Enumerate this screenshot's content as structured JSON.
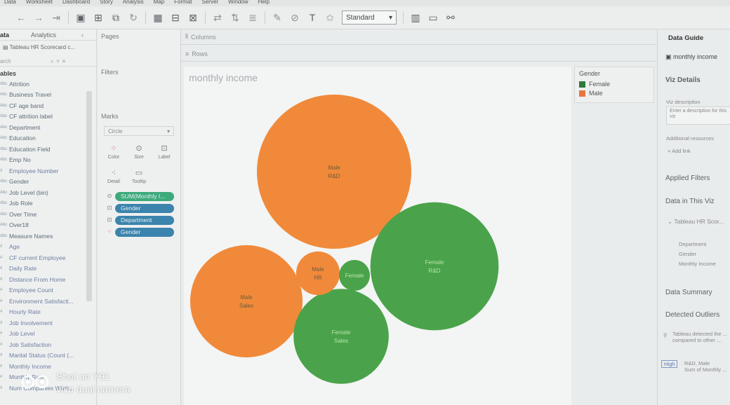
{
  "menu": [
    "Data",
    "Worksheet",
    "Dashboard",
    "Story",
    "Analysis",
    "Map",
    "Format",
    "Server",
    "Window",
    "Help"
  ],
  "toolbar": {
    "fit_value": "Standard",
    "icons": [
      "undo-icon",
      "redo-icon",
      "save-icon",
      "new-datasource-icon",
      "new-sheet-icon",
      "refresh-icon",
      "swap-icon",
      "sort-ascending-icon",
      "sort-descending-icon",
      "highlight-icon",
      "group-icon",
      "label-icon",
      "pin-icon",
      "show-me-icon",
      "presentation-icon",
      "share-icon"
    ]
  },
  "data_pane": {
    "tab_data": "ata",
    "tab_analytics": "Analytics",
    "datasource": "Tableau HR Scorecard c...",
    "search_placeholder": "arch",
    "tables_header": "ables",
    "fields": [
      {
        "type": "Abc",
        "name": "Attrition"
      },
      {
        "type": "Abc",
        "name": "Business Travel"
      },
      {
        "type": "Abc",
        "name": "CF age band"
      },
      {
        "type": "Abc",
        "name": "CF attrition label"
      },
      {
        "type": "Abc",
        "name": "Department"
      },
      {
        "type": "Abc",
        "name": "Education"
      },
      {
        "type": "Abc",
        "name": "Education Field"
      },
      {
        "type": "Abc",
        "name": "Emp No"
      },
      {
        "type": "#",
        "name": "Employee Number"
      },
      {
        "type": "Abc",
        "name": "Gender"
      },
      {
        "type": "Abc",
        "name": "Job Level (bin)"
      },
      {
        "type": "Abc",
        "name": "Job Role"
      },
      {
        "type": "Abc",
        "name": "Over Time"
      },
      {
        "type": "Abc",
        "name": "Over18"
      },
      {
        "type": "Abc",
        "name": "Measure Names"
      },
      {
        "type": "#",
        "name": "Age"
      },
      {
        "type": "#",
        "name": "CF current Employee"
      },
      {
        "type": "#",
        "name": "Daily Rate"
      },
      {
        "type": "#",
        "name": "Distance From Home"
      },
      {
        "type": "#",
        "name": "Employee Count"
      },
      {
        "type": "#",
        "name": "Environment Satisfacti..."
      },
      {
        "type": "#",
        "name": "Hourly Rate"
      },
      {
        "type": "#",
        "name": "Job Involvement"
      },
      {
        "type": "#",
        "name": "Job Level"
      },
      {
        "type": "#",
        "name": "Job Satisfaction"
      },
      {
        "type": "#",
        "name": "Marital Status (Count (..."
      },
      {
        "type": "#",
        "name": "Monthly Income"
      },
      {
        "type": "#",
        "name": "Monthly Rate"
      },
      {
        "type": "#",
        "name": "Num Companies Work..."
      }
    ]
  },
  "cards": {
    "pages": "Pages",
    "filters": "Filters",
    "marks": "Marks",
    "mark_type": "Circle",
    "buttons": [
      "Color",
      "Size",
      "Label",
      "Detail",
      "Tooltip"
    ],
    "pills": [
      {
        "label": "SUM(Monthly I...",
        "color": "green"
      },
      {
        "label": "Gender",
        "color": "blue"
      },
      {
        "label": "Department",
        "color": "blue"
      },
      {
        "label": "Gender",
        "color": "blue"
      }
    ]
  },
  "shelves": {
    "columns": "Columns",
    "rows": "Rows"
  },
  "viz": {
    "title": "monthly income",
    "colors": {
      "Male": "#f08a3a",
      "Female": "#4aa34a"
    }
  },
  "chart_data": {
    "type": "bubble",
    "title": "monthly income",
    "size_measure": "SUM(Monthly Income)",
    "color_dimension": "Gender",
    "bubbles": [
      {
        "gender": "Male",
        "department": "R&D",
        "value": 1000
      },
      {
        "gender": "Female",
        "department": "R&D",
        "value": 690
      },
      {
        "gender": "Male",
        "department": "Sales",
        "value": 530
      },
      {
        "gender": "Female",
        "department": "Sales",
        "value": 380
      },
      {
        "gender": "Male",
        "department": "HR",
        "value": 80
      },
      {
        "gender": "Female",
        "department": "HR",
        "value": 40
      }
    ]
  },
  "legend": {
    "title": "Gender",
    "items": [
      {
        "label": "Female",
        "color": "#2e7a3c"
      },
      {
        "label": "Male",
        "color": "#e8763c"
      }
    ]
  },
  "guide": {
    "header": "Data Guide",
    "sheet_name": "monthly income",
    "viz_details": "Viz Details",
    "viz_description_label": "Viz description",
    "viz_description_placeholder": "Enter a description for this viz",
    "additional_resources": "Additional resources",
    "add_link": "Add link",
    "applied_filters": "Applied Filters",
    "data_in_viz": "Data in This Viz",
    "datasource": "Tableau HR Scor...",
    "viz_fields": [
      "Department",
      "Gender",
      "Monthly Income"
    ],
    "data_summary": "Data Summary",
    "detected_outliers": "Detected Outliers",
    "outlier_text": "Tableau detected the ... compared to other ...",
    "outlier_badge": "High",
    "outlier_item": "R&D, Male",
    "outlier_item_sub": "Sum of Monthly ..."
  },
  "watermark": {
    "line1": "Shot on Y91",
    "line2": "vivo dual camera"
  }
}
